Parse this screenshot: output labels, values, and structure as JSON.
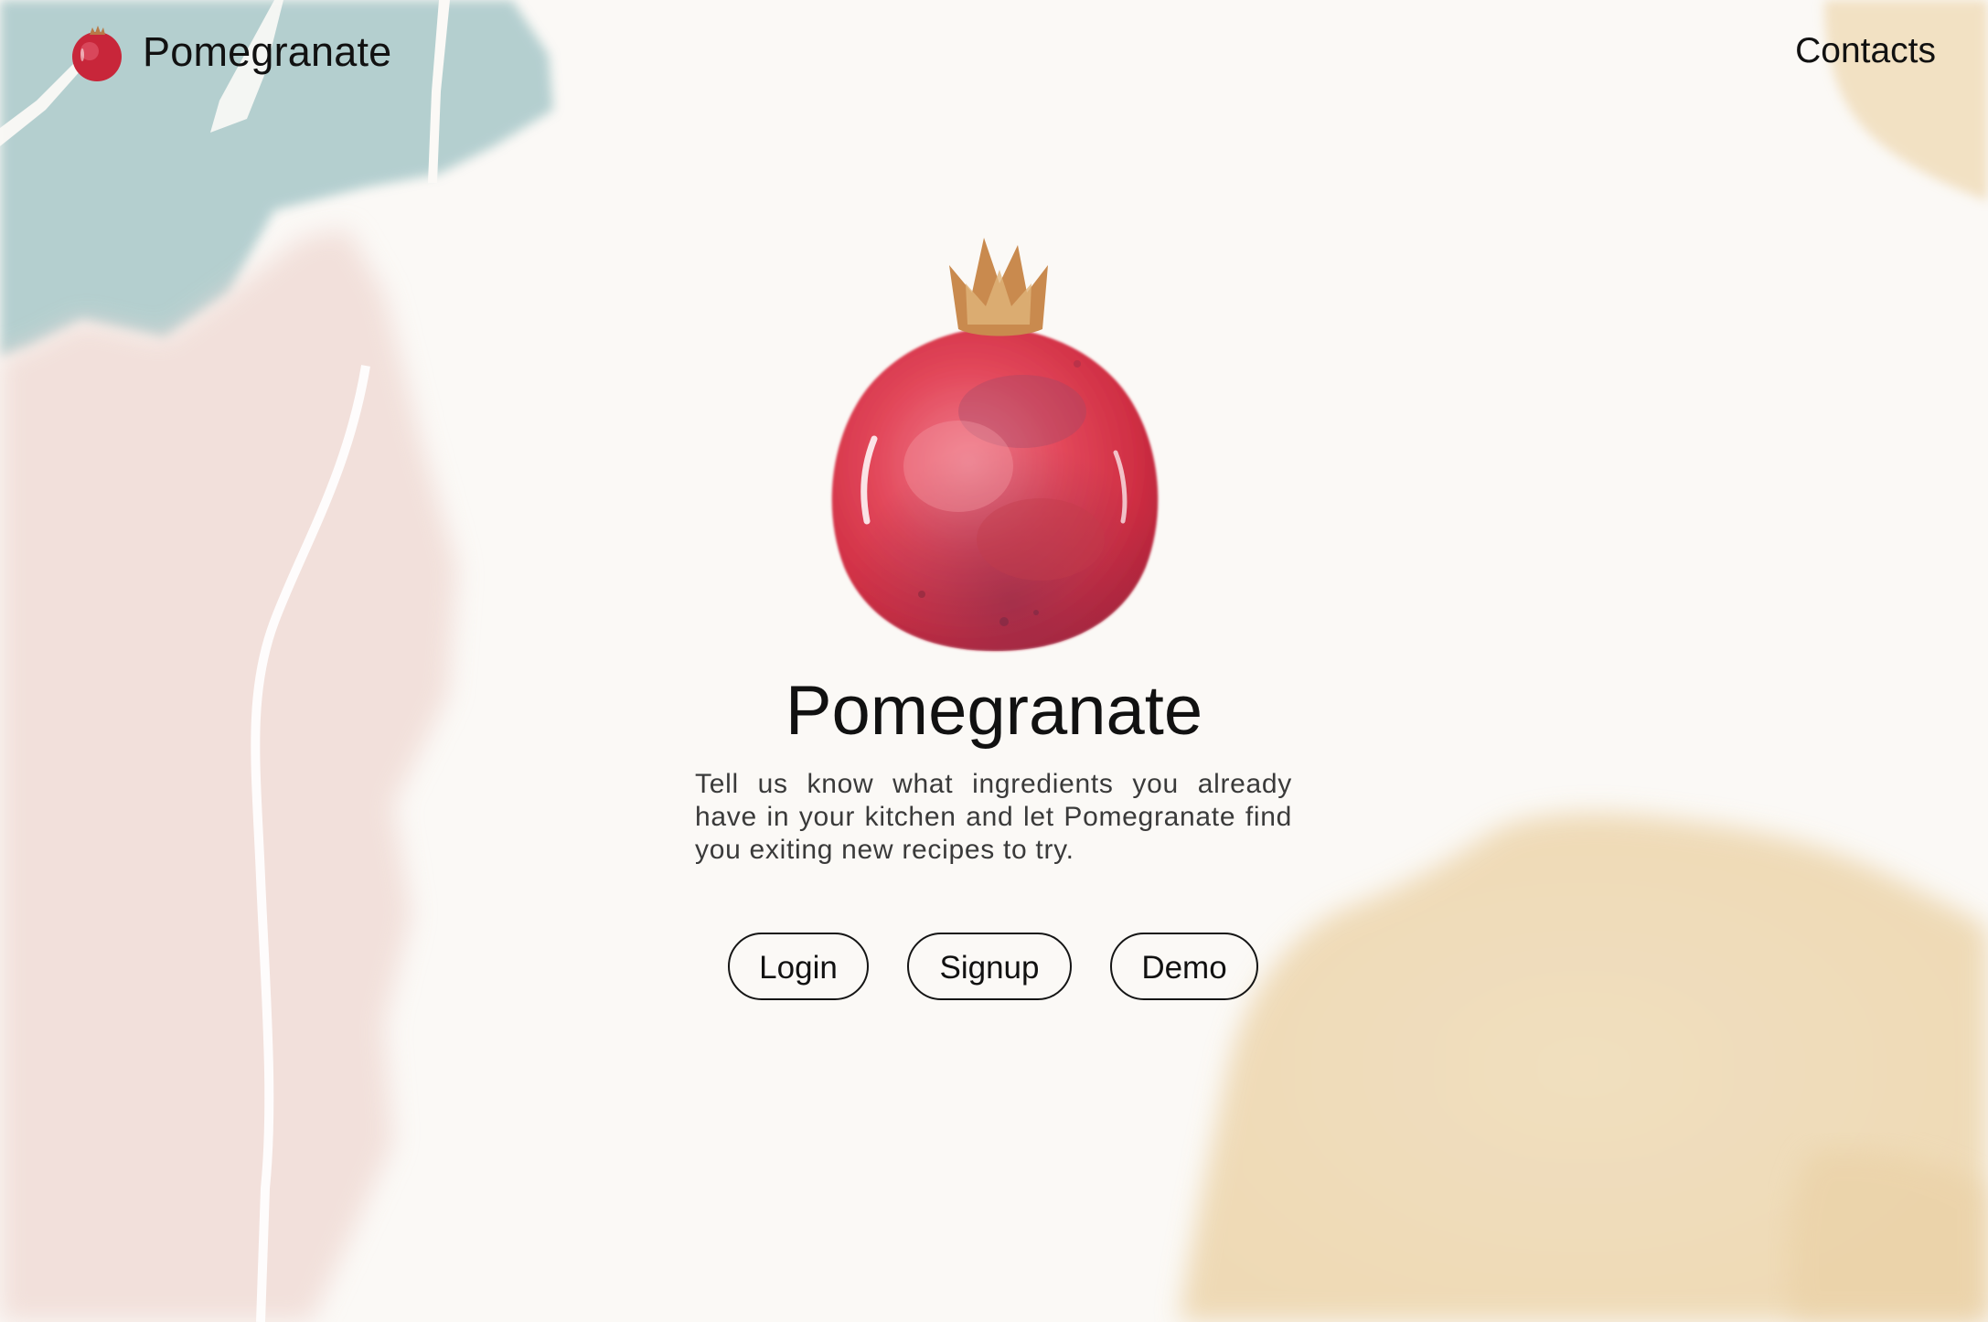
{
  "header": {
    "brand_name": "Pomegranate",
    "brand_icon": "pomegranate-icon",
    "contacts_label": "Contacts"
  },
  "hero": {
    "illustration": "pomegranate-illustration",
    "title": "Pomegranate",
    "description": "Tell us know what ingredients you already have in your kitchen and let Pomegranate find you exiting new recipes to try."
  },
  "actions": {
    "login_label": "Login",
    "signup_label": "Signup",
    "demo_label": "Demo"
  },
  "colors": {
    "background": "#fbf9f6",
    "accent_red": "#d23a4a",
    "watercolor_blue": "#a9cacb",
    "watercolor_pink": "#efd8d2",
    "watercolor_tan": "#efd9b3",
    "button_border": "#151515"
  }
}
